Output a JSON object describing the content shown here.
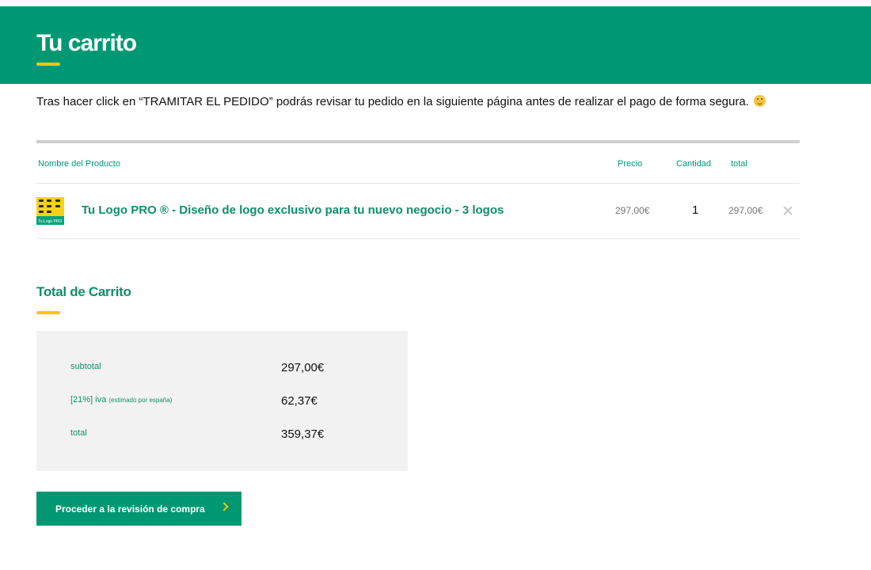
{
  "header": {
    "title": "Tu carrito"
  },
  "intro": {
    "text": "Tras hacer click en “TRAMITAR EL PEDIDO” podrás revisar tu pedido en la siguiente página antes de realizar el pago de forma segura.",
    "emoji_icon": "smiley-icon"
  },
  "cart_table": {
    "columns": {
      "name": "Nombre del Producto",
      "price": "Precio",
      "quantity": "Cantidad",
      "total": "total"
    },
    "rows": [
      {
        "thumbnail_icon": "product-thumbnail",
        "thumbnail_caption": "Tu Logo PRO",
        "name": "Tu Logo PRO ® - Diseño de logo exclusivo para tu nuevo negocio - 3 logos",
        "price": "297,00€",
        "quantity": "1",
        "total": "297,00€",
        "remove_icon": "close-icon"
      }
    ]
  },
  "totals": {
    "title": "Total de Carrito",
    "subtotal_label": "subtotal",
    "subtotal_value": "297,00€",
    "tax_label": "[21%] iva",
    "tax_note": "(estimado por españa)",
    "tax_value": "62,37€",
    "total_label": "total",
    "total_value": "359,37€"
  },
  "actions": {
    "proceed_label": "Proceder a la revisión de compra",
    "proceed_icon": "chevron-right-icon"
  },
  "colors": {
    "brand_green": "#009873",
    "accent_yellow": "#f5c800",
    "box_gray": "#f2f2f2"
  }
}
